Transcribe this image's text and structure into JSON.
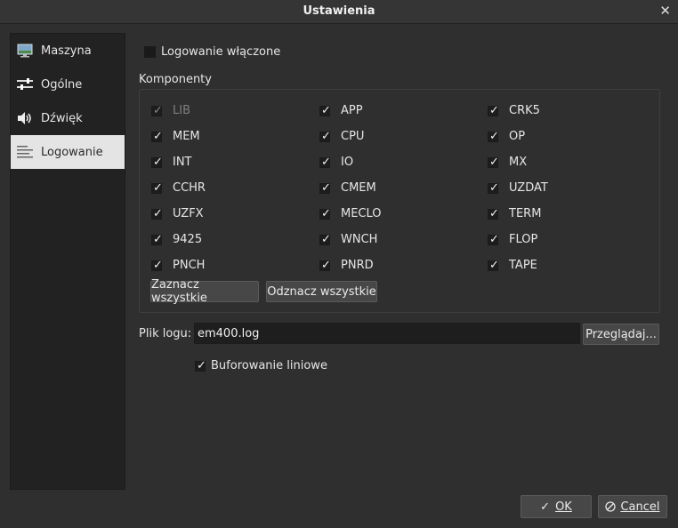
{
  "window": {
    "title": "Ustawienia",
    "close_glyph": "✕"
  },
  "sidebar": {
    "items": [
      {
        "label": "Maszyna",
        "icon": "monitor-icon"
      },
      {
        "label": "Ogólne",
        "icon": "sliders-icon"
      },
      {
        "label": "Dźwięk",
        "icon": "speaker-icon"
      },
      {
        "label": "Logowanie",
        "icon": "list-lines-icon",
        "active": true
      }
    ]
  },
  "logging": {
    "enabled_label": "Logowanie włączone",
    "enabled": false,
    "components_title": "Komponenty",
    "components": [
      [
        {
          "label": "LIB",
          "checked": true,
          "disabled": true
        },
        {
          "label": "APP",
          "checked": true
        },
        {
          "label": "CRK5",
          "checked": true
        }
      ],
      [
        {
          "label": "MEM",
          "checked": true
        },
        {
          "label": "CPU",
          "checked": true
        },
        {
          "label": "OP",
          "checked": true
        }
      ],
      [
        {
          "label": "INT",
          "checked": true
        },
        {
          "label": "IO",
          "checked": true
        },
        {
          "label": "MX",
          "checked": true
        }
      ],
      [
        {
          "label": "CCHR",
          "checked": true
        },
        {
          "label": "CMEM",
          "checked": true
        },
        {
          "label": "UZDAT",
          "checked": true
        }
      ],
      [
        {
          "label": "UZFX",
          "checked": true
        },
        {
          "label": "MECLO",
          "checked": true
        },
        {
          "label": "TERM",
          "checked": true
        }
      ],
      [
        {
          "label": "9425",
          "checked": true
        },
        {
          "label": "WNCH",
          "checked": true
        },
        {
          "label": "FLOP",
          "checked": true
        }
      ],
      [
        {
          "label": "PNCH",
          "checked": true
        },
        {
          "label": "PNRD",
          "checked": true
        },
        {
          "label": "TAPE",
          "checked": true
        }
      ]
    ],
    "select_all_label": "Zaznacz wszystkie",
    "deselect_all_label": "Odznacz wszystkie",
    "log_file_label": "Plik logu:",
    "log_file_value": "em400.log",
    "browse_label": "Przeglądaj...",
    "line_buffering_label": "Buforowanie liniowe",
    "line_buffering": true
  },
  "footer": {
    "ok_label": "OK",
    "cancel_label": "Cancel"
  },
  "check_glyph": "✓"
}
